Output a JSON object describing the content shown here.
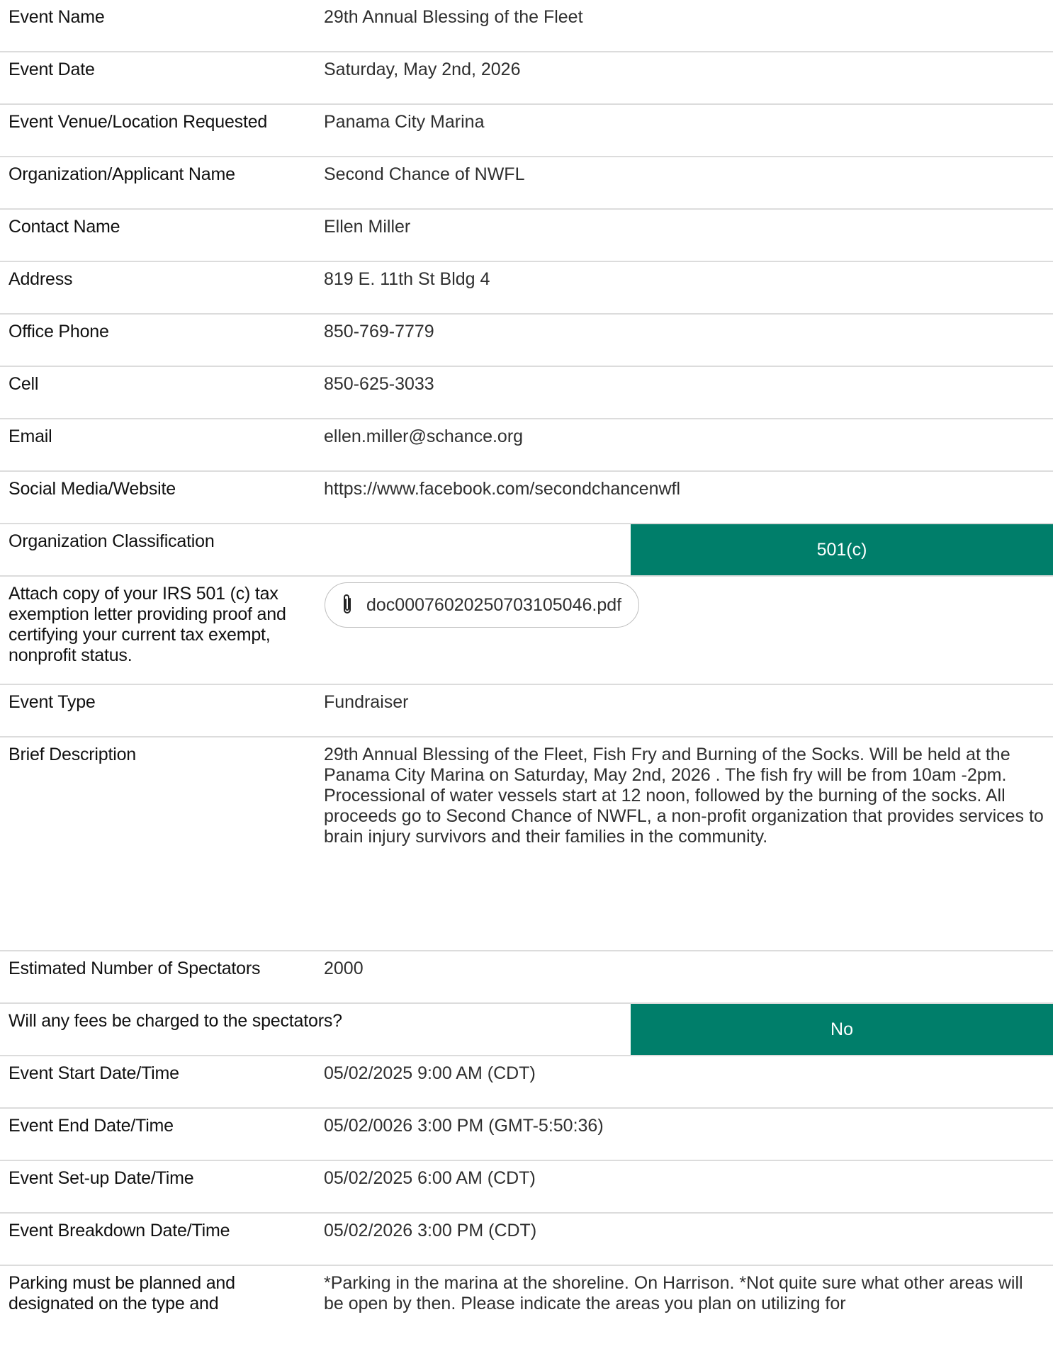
{
  "rows": [
    {
      "label": "Event Name",
      "value": "29th Annual Blessing of the Fleet"
    },
    {
      "label": "Event Date",
      "value": "Saturday, May 2nd, 2026"
    },
    {
      "label": "Event Venue/Location Requested",
      "value": "Panama City Marina"
    },
    {
      "label": "Organization/Applicant Name",
      "value": "Second Chance of NWFL"
    },
    {
      "label": "Contact Name",
      "value": "Ellen Miller"
    },
    {
      "label": "Address",
      "value": "819 E. 11th St Bldg 4"
    },
    {
      "label": "Office Phone",
      "value": "850-769-7779"
    },
    {
      "label": "Cell",
      "value": "850-625-3033"
    },
    {
      "label": "Email",
      "value": "ellen.miller@schance.org"
    },
    {
      "label": "Social Media/Website",
      "value": "https://www.facebook.com/secondchancenwfl"
    }
  ],
  "classification": {
    "label": "Organization Classification",
    "selected": "501(c)"
  },
  "attachment": {
    "label": "Attach copy of your IRS 501 (c) tax exemption letter providing proof and certifying your current tax exempt, nonprofit status.",
    "file_name": "doc00076020250703105046.pdf",
    "icon": "paperclip-icon"
  },
  "event_type": {
    "label": "Event Type",
    "value": "Fundraiser"
  },
  "description": {
    "label": "Brief Description",
    "value": "29th Annual Blessing of the Fleet, Fish Fry and Burning of the Socks.  Will be held at the Panama City Marina on Saturday, May 2nd, 2026 .  The fish fry will be from 10am -2pm.  Processional of water vessels start at 12 noon, followed by the burning of the socks.  All proceeds go to Second Chance of NWFL, a non-profit organization that provides services to brain injury survivors and their families in the community."
  },
  "spectators": {
    "label": "Estimated Number of Spectators",
    "value": "2000"
  },
  "fees": {
    "label": "Will any fees be charged to the spectators?",
    "selected": "No"
  },
  "times": [
    {
      "label": "Event Start Date/Time",
      "value": "05/02/2025 9:00 AM (CDT)"
    },
    {
      "label": "Event End Date/Time",
      "value": "05/02/0026 3:00 PM (GMT-5:50:36)"
    },
    {
      "label": "Event Set-up Date/Time",
      "value": "05/02/2025 6:00 AM (CDT)"
    },
    {
      "label": "Event Breakdown Date/Time",
      "value": "05/02/2026 3:00 PM (CDT)"
    }
  ],
  "parking": {
    "label": "Parking must be planned and designated on the type and",
    "value": "*Parking in the marina at the shoreline.  On Harrison.  *Not quite sure what other areas will be open by then. Please indicate the areas you plan on utilizing for"
  },
  "colors": {
    "accent": "#007e6a",
    "divider": "#dcdcdc"
  }
}
